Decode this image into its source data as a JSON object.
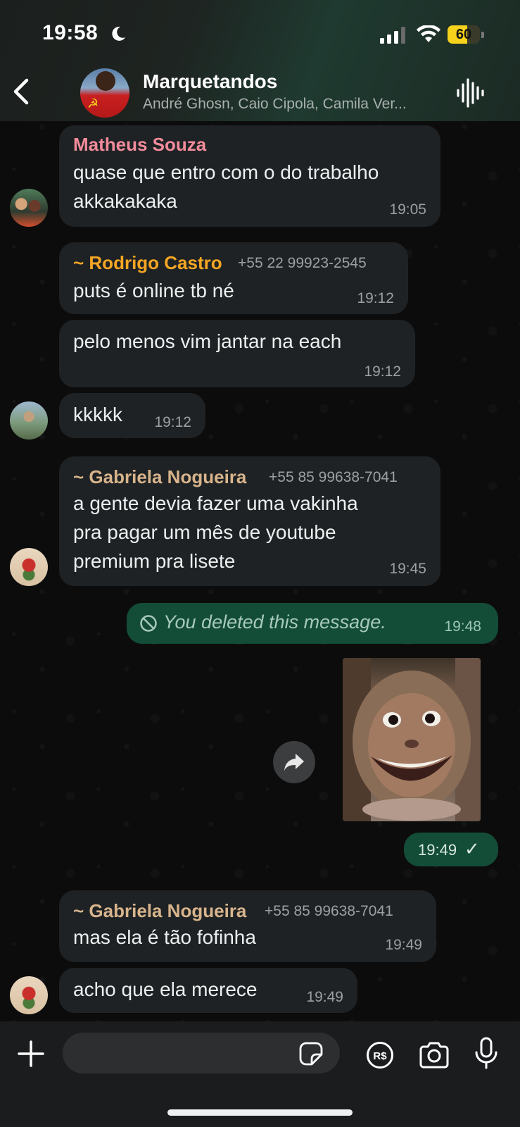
{
  "status_bar": {
    "time": "19:58",
    "battery": "60",
    "battery_level": 0.6
  },
  "header": {
    "title": "Marquetandos",
    "members": "André Ghosn, Caio Cipola, Camila Ver..."
  },
  "messages": [
    {
      "sender": "Matheus Souza",
      "sender_color": "#f28b9b",
      "lines": [
        "quase que entro com o do trabalho",
        "akkakakaka"
      ],
      "time": "19:05"
    },
    {
      "sender": "~ Rodrigo Castro",
      "sender_color": "#f5a623",
      "phone": "+55 22 99923-2545",
      "lines": [
        "puts é online tb né"
      ],
      "time": "19:12"
    },
    {
      "lines": [
        "pelo menos vim jantar na each"
      ],
      "time": "19:12"
    },
    {
      "lines": [
        "kkkkk"
      ],
      "time": "19:12"
    },
    {
      "sender": "~ Gabriela Nogueira",
      "sender_color": "#d7b48c",
      "phone": "+55 85 99638-7041",
      "lines": [
        "a gente devia fazer uma vakinha",
        "pra pagar um mês de youtube",
        "premium pra lisete"
      ],
      "time": "19:45"
    },
    {
      "deleted_text": "You deleted this message.",
      "time": "19:48"
    },
    {
      "image_time": "19:49",
      "status": "✓"
    },
    {
      "sender": "~ Gabriela Nogueira",
      "sender_color": "#d7b48c",
      "phone": "+55 85 99638-7041",
      "lines": [
        "mas ela é tão fofinha"
      ],
      "time": "19:49"
    },
    {
      "lines": [
        "acho que ela merece"
      ],
      "time": "19:49"
    }
  ],
  "colors": {
    "incoming_bubble": "#1f2224",
    "outgoing_bubble": "#134d37",
    "header_bg": "#1e2421"
  },
  "composer": {
    "input_value": ""
  },
  "icons": [
    "back-icon",
    "audio-wave-icon",
    "forward-icon",
    "plus-icon",
    "sticker-icon",
    "pix-payment-icon",
    "camera-icon",
    "microphone-icon",
    "blocked-icon",
    "moon-icon",
    "signal-icon",
    "wifi-icon"
  ]
}
